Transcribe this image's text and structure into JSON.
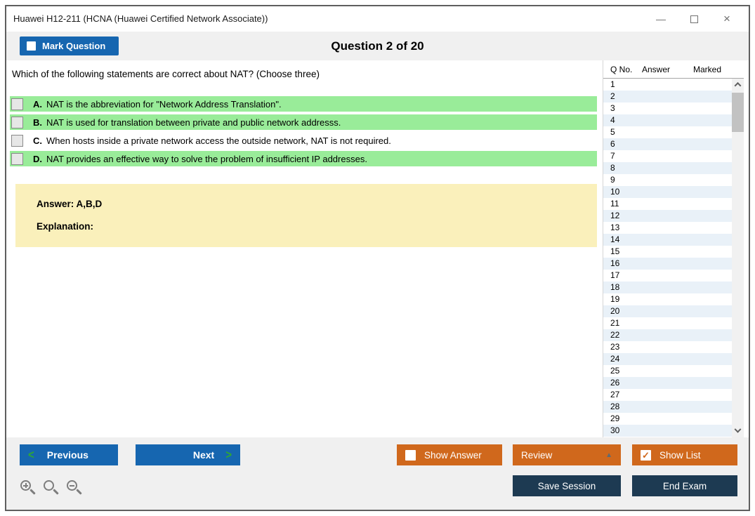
{
  "window": {
    "title": "Huawei H12-211 (HCNA (Huawei Certified Network Associate))",
    "minimize_glyph": "—",
    "close_glyph": "×"
  },
  "header": {
    "mark_question": "Mark Question",
    "counter": "Question 2 of 20"
  },
  "question": {
    "text": "Which of the following statements are correct about NAT? (Choose three)",
    "options": [
      {
        "letter": "A.",
        "text": "NAT is the abbreviation for \"Network Address Translation\".",
        "correct": true
      },
      {
        "letter": "B.",
        "text": "NAT is used for translation between private and public network addresss.",
        "correct": true
      },
      {
        "letter": "C.",
        "text": "When hosts inside a private network access the outside network, NAT is not required.",
        "correct": false
      },
      {
        "letter": "D.",
        "text": "NAT provides an effective way to solve the problem of insufficient IP addresses.",
        "correct": true
      }
    ],
    "answer": "Answer: A,B,D",
    "explanation": "Explanation:"
  },
  "question_list": {
    "columns": {
      "qno": "Q No.",
      "answer": "Answer",
      "marked": "Marked"
    },
    "visible_rows": [
      1,
      2,
      3,
      4,
      5,
      6,
      7,
      8,
      9,
      10,
      11,
      12,
      13,
      14,
      15,
      16,
      17,
      18,
      19,
      20,
      21,
      22,
      23,
      24,
      25,
      26,
      27,
      28,
      29,
      30
    ]
  },
  "footer": {
    "previous": "Previous",
    "next": "Next",
    "prev_chevron": "<",
    "next_chevron": ">",
    "show_answer": "Show Answer",
    "review": "Review",
    "review_arrow": "▲",
    "show_list": "Show List",
    "check_glyph": "✓",
    "save_session": "Save Session",
    "end_exam": "End Exam"
  },
  "colors": {
    "accent_blue": "#1666b0",
    "accent_orange": "#d0681c",
    "navy": "#1d3a52",
    "highlight_green": "#99ec99",
    "answer_yellow": "#faf0bb",
    "alt_row_blue": "#e9f1f8",
    "chevron_green": "#2fa832"
  }
}
